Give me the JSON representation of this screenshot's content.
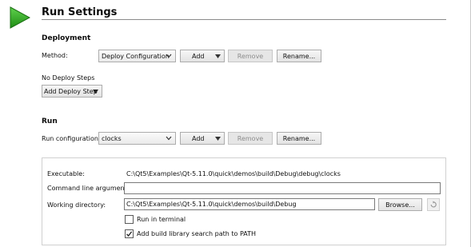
{
  "header": {
    "title": "Run Settings",
    "run_icon": "play-icon",
    "accent_color": "#27a11c"
  },
  "deployment": {
    "heading": "Deployment",
    "method_label": "Method:",
    "method_value": "Deploy Configuration",
    "add_label": "Add",
    "remove_label": "Remove",
    "rename_label": "Rename...",
    "no_steps_label": "No Deploy Steps",
    "add_step_label": "Add Deploy Step"
  },
  "run": {
    "heading": "Run",
    "config_label": "Run configuration:",
    "config_value": "clocks",
    "add_label": "Add",
    "remove_label": "Remove",
    "rename_label": "Rename..."
  },
  "details": {
    "executable_label": "Executable:",
    "executable_value": "C:\\Qt5\\Examples\\Qt-5.11.0\\quick\\demos\\build\\Debug\\debug\\clocks",
    "args_label": "Command line arguments:",
    "args_value": "",
    "workdir_label": "Working directory:",
    "workdir_value": "C:\\Qt5\\Examples\\Qt-5.11.0\\quick\\demos\\build\\Debug",
    "browse_label": "Browse...",
    "run_in_terminal_label": "Run in terminal",
    "run_in_terminal_checked": false,
    "add_lib_path_label": "Add build library search path to PATH",
    "add_lib_path_checked": true
  }
}
